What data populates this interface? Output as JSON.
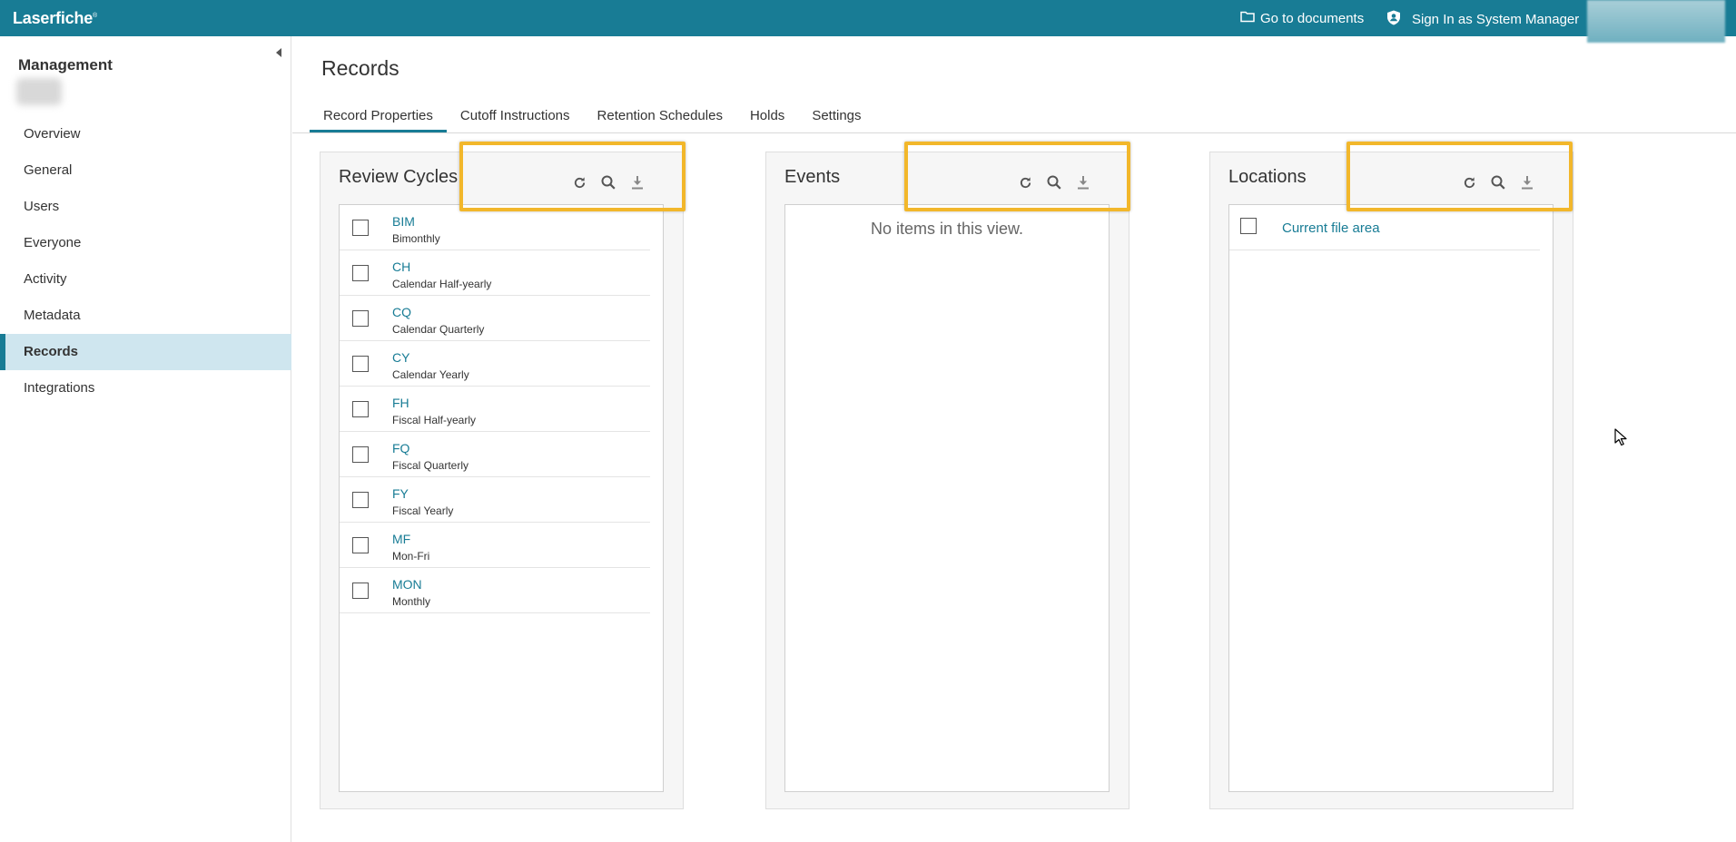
{
  "topbar": {
    "brand": "Laserfiche",
    "brand_mark": "®",
    "go_to_documents": "Go to documents",
    "sign_in": "Sign In as System Manager"
  },
  "sidebar": {
    "title": "Management",
    "items": [
      {
        "label": "Overview"
      },
      {
        "label": "General"
      },
      {
        "label": "Users"
      },
      {
        "label": "Everyone"
      },
      {
        "label": "Activity"
      },
      {
        "label": "Metadata"
      },
      {
        "label": "Records",
        "active": true
      },
      {
        "label": "Integrations"
      }
    ]
  },
  "main": {
    "title": "Records",
    "tabs": [
      {
        "label": "Record Properties",
        "active": true
      },
      {
        "label": "Cutoff Instructions"
      },
      {
        "label": "Retention Schedules"
      },
      {
        "label": "Holds"
      },
      {
        "label": "Settings"
      }
    ]
  },
  "panels": {
    "review_cycles": {
      "title": "Review Cycles",
      "rows": [
        {
          "code": "BIM",
          "desc": "Bimonthly"
        },
        {
          "code": "CH",
          "desc": "Calendar Half-yearly"
        },
        {
          "code": "CQ",
          "desc": "Calendar Quarterly"
        },
        {
          "code": "CY",
          "desc": "Calendar Yearly"
        },
        {
          "code": "FH",
          "desc": "Fiscal Half-yearly"
        },
        {
          "code": "FQ",
          "desc": "Fiscal Quarterly"
        },
        {
          "code": "FY",
          "desc": "Fiscal Yearly"
        },
        {
          "code": "MF",
          "desc": "Mon-Fri"
        },
        {
          "code": "MON",
          "desc": "Monthly"
        }
      ]
    },
    "events": {
      "title": "Events",
      "empty_text": "No items in this view."
    },
    "locations": {
      "title": "Locations",
      "rows": [
        {
          "code": "Current file area"
        }
      ]
    }
  },
  "icons": {
    "refresh": "refresh-icon",
    "search": "search-icon",
    "download": "download-icon",
    "folder": "folder-icon",
    "user_shield": "user-shield-icon"
  },
  "colors": {
    "brand": "#187c95",
    "highlight": "#f2b72b",
    "active_nav_bg": "#cfe6ef"
  }
}
